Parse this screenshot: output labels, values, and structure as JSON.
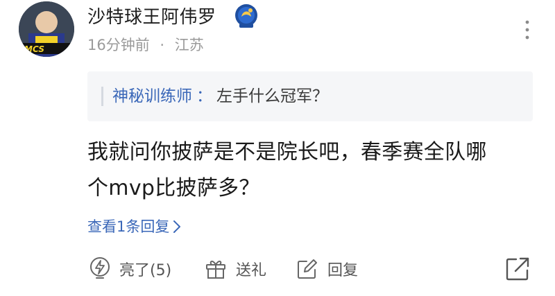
{
  "comment": {
    "username": "沙特球王阿伟罗",
    "time": "16分钟前",
    "separator": "·",
    "location": "江苏",
    "quote": {
      "author": "神秘训练师",
      "separator": "：",
      "text": "左手什么冠军？"
    },
    "content_lines": [
      "我就问你披萨是不是院长吧，春季赛全队哪",
      "个mvp比披萨多？"
    ],
    "view_replies": "查看1条回复"
  },
  "actions": {
    "like_label": "亮了(5)",
    "gift_label": "送礼",
    "reply_label": "回复"
  },
  "colors": {
    "link": "#3a67b8",
    "meta": "#9a9a9a",
    "quote_bg": "#f5f6f8"
  },
  "icons": [
    "avatar",
    "badge-icon",
    "more-vertical-icon",
    "chevron-right-icon",
    "lightning-icon",
    "gift-icon",
    "edit-icon",
    "share-icon"
  ]
}
